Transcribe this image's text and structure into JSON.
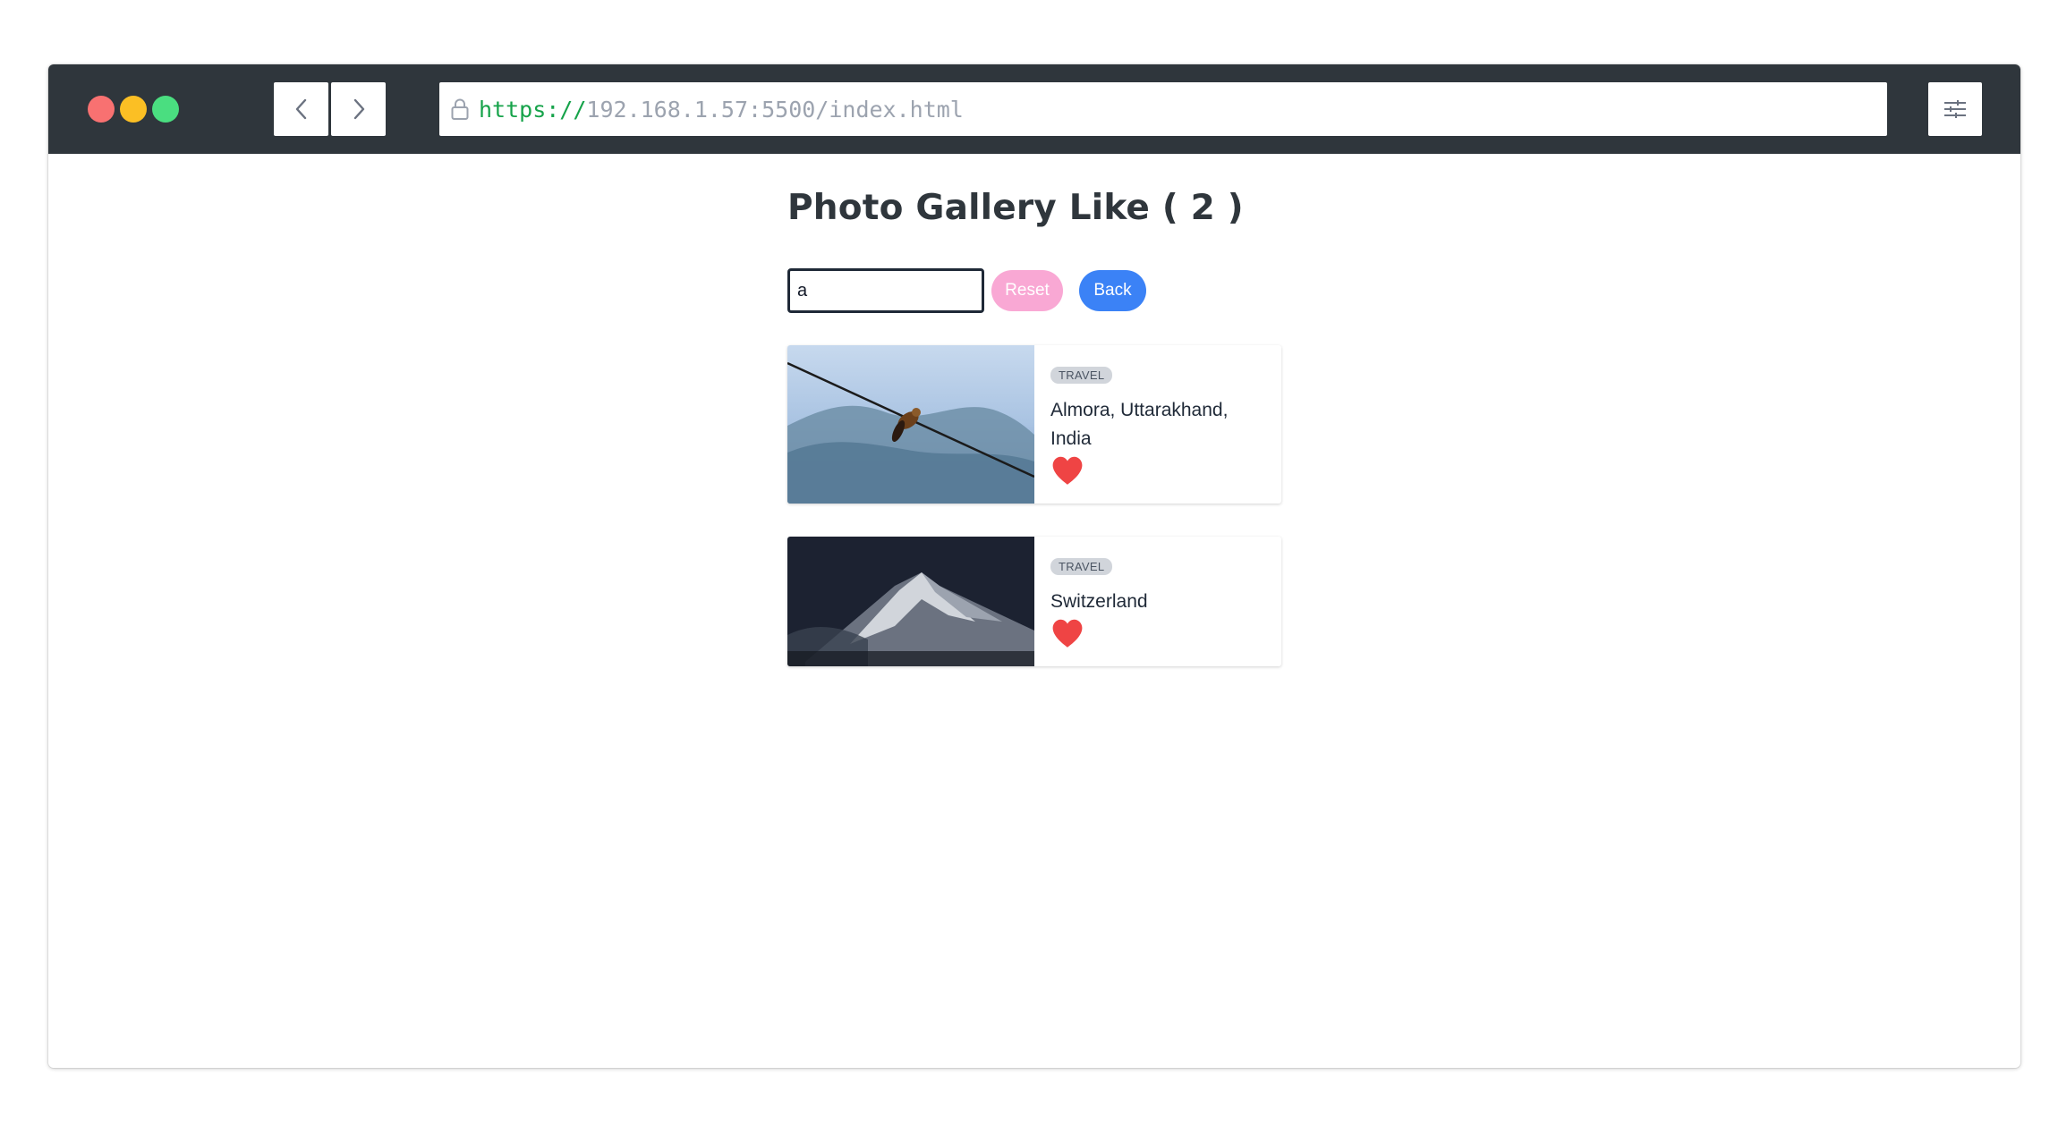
{
  "browser": {
    "url_scheme": "https://",
    "url_rest": "192.168.1.57:5500/index.html",
    "icons": [
      "back-icon",
      "forward-icon",
      "lock-icon",
      "settings-sliders-icon"
    ]
  },
  "page": {
    "title": "Photo Gallery Like ( 2 )",
    "search_value": "a",
    "reset_label": "Reset",
    "back_label": "Back"
  },
  "cards": [
    {
      "category": "TRAVEL",
      "title": "Almora, Uttarakhand, India",
      "liked": true
    },
    {
      "category": "TRAVEL",
      "title": "Switzerland",
      "liked": true
    }
  ],
  "colors": {
    "titlebar": "#2f363c",
    "heart": "#ef4444",
    "reset": "#f9a8d4",
    "back": "#3b82f6",
    "url_scheme": "#16a34a"
  }
}
